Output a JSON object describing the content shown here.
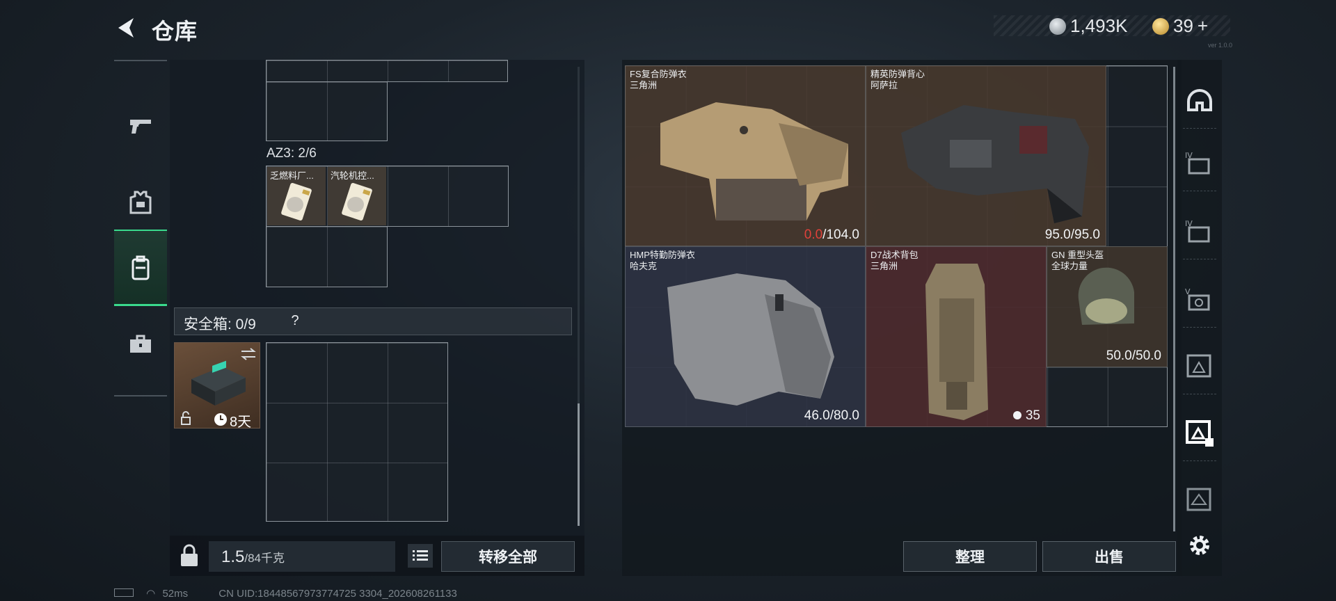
{
  "header": {
    "title": "仓库",
    "money_value": "1,493K",
    "gold_value": "39",
    "gold_add": "+",
    "version": "ver 1.0.0"
  },
  "side_nav": {
    "items": [
      {
        "icon": "pistol-icon",
        "active": false
      },
      {
        "icon": "armor-rig-icon",
        "active": false
      },
      {
        "icon": "backpack-icon",
        "active": true
      },
      {
        "icon": "briefcase-icon",
        "active": false
      }
    ]
  },
  "left_panel": {
    "container_label": "AZ3: 2/6",
    "items": [
      {
        "name": "乏燃料厂...",
        "icon": "capsule-item-icon"
      },
      {
        "name": "汽轮机控...",
        "icon": "capsule-item-icon"
      }
    ],
    "safebox_label": "安全箱: 0/9",
    "safebox_help": "?",
    "safebox_days": "8天",
    "weight_value": "1.5",
    "weight_max": "/84千克",
    "transfer_all_label": "转移全部"
  },
  "stash": {
    "items": [
      {
        "name": "FS复合防弹衣",
        "faction": "三角洲",
        "durability_current": "0.0",
        "durability_total": "/104.0",
        "rarity_color": "#4a3a2e"
      },
      {
        "name": "精英防弹背心",
        "faction": "阿萨拉",
        "durability_current": "95.0",
        "durability_total": "/95.0",
        "rarity_color": "#4a3a2e"
      },
      {
        "name": "HMP特勤防弹衣",
        "faction": "哈夫克",
        "durability_current": "46.0",
        "durability_total": "/80.0",
        "rarity_color": "#2e3242"
      },
      {
        "name": "D7战术背包",
        "faction": "三角洲",
        "durability_current": "35",
        "durability_total": "",
        "rarity_color": "#4e2a2e"
      },
      {
        "name": "GN 重型头盔",
        "faction": "全球力量",
        "durability_current": "50.0",
        "durability_total": "/50.0",
        "rarity_color": "#3e342c"
      }
    ],
    "sort_label": "整理",
    "sell_label": "出售"
  },
  "right_nav": {
    "items": [
      "helmet-slot-icon",
      "armor-iv-icon",
      "armor-iv-alt-icon",
      "armor-v-icon",
      "backpack-slot-icon",
      "backpack-slot-active-icon",
      "case-slot-icon",
      "settings-icon"
    ]
  },
  "status": {
    "ping": "52ms",
    "uid": "CN UID:18448567973774725 3304_202608261133"
  },
  "colors": {
    "accent": "#3adb8d",
    "durability_zero": "#e0413a"
  }
}
